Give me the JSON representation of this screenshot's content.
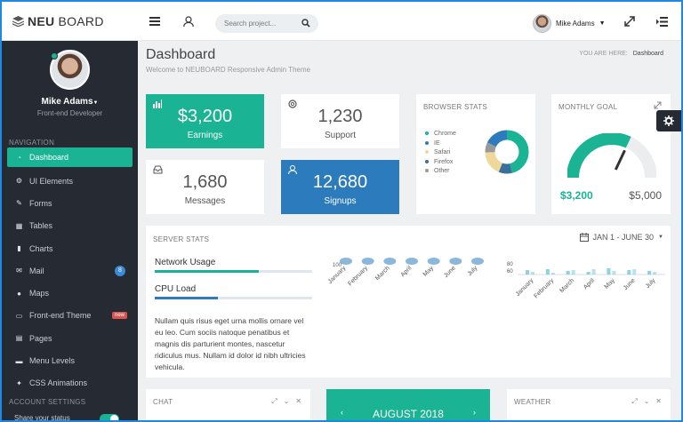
{
  "brand": {
    "logo_bold": "NEU",
    "logo_rest": "BOARD"
  },
  "topbar": {
    "search_placeholder": "Search project...",
    "user_name": "Mike Adams",
    "icons": [
      "menu-icon",
      "user-icon",
      "search-icon",
      "expand-icon",
      "list-toggle-icon"
    ]
  },
  "sidebar": {
    "profile_name": "Mike Adams",
    "profile_role": "Front-end Developer",
    "nav_heading": "NAVIGATION",
    "items": [
      {
        "label": "Dashboard",
        "icon": "dashboard-icon"
      },
      {
        "label": "UI Elements",
        "icon": "cogs-icon"
      },
      {
        "label": "Forms",
        "icon": "edit-icon"
      },
      {
        "label": "Tables",
        "icon": "table-icon"
      },
      {
        "label": "Charts",
        "icon": "bar-chart-icon"
      },
      {
        "label": "Mail",
        "icon": "mail-icon",
        "badge": "8"
      },
      {
        "label": "Maps",
        "icon": "map-marker-icon"
      },
      {
        "label": "Front-end Theme",
        "icon": "desktop-icon",
        "badge": "new"
      },
      {
        "label": "Pages",
        "icon": "file-icon"
      },
      {
        "label": "Menu Levels",
        "icon": "folder-icon"
      },
      {
        "label": "CSS Animations",
        "icon": "magic-icon"
      }
    ],
    "settings_heading": "ACCOUNT SETTINGS",
    "status_label": "Share your status",
    "accent": "#1ab394"
  },
  "page": {
    "title": "Dashboard",
    "subtitle": "Welcome to NEUBOARD Responsive Admin Theme",
    "breadcrumb_label": "YOU ARE HERE:",
    "breadcrumb_current": "Dashboard"
  },
  "stats": [
    {
      "value": "$3,200",
      "label": "Earnings"
    },
    {
      "value": "1,230",
      "label": "Support"
    },
    {
      "value": "1,680",
      "label": "Messages"
    },
    {
      "value": "12,680",
      "label": "Signups"
    }
  ],
  "browser_stats": {
    "title": "BROWSER STATS",
    "legend": [
      {
        "name": "Chrome",
        "color": "#1ab394"
      },
      {
        "name": "IE",
        "color": "#2b7bbd"
      },
      {
        "name": "Safari",
        "color": "#f0d79a"
      },
      {
        "name": "Firefox",
        "color": "#3a6f9a"
      },
      {
        "name": "Other",
        "color": "#999999"
      }
    ]
  },
  "monthly_goal": {
    "title": "MONTHLY GOAL",
    "current": "$3,200",
    "target": "$5,000",
    "progress": 0.64
  },
  "server_stats": {
    "title": "SERVER STATS",
    "date_range": "JAN 1 - JUNE 30",
    "bars": [
      {
        "label": "Network Usage",
        "value": 0.66
      },
      {
        "label": "CPU Load",
        "value": 0.4
      }
    ],
    "text": "Nullam quis risus eget urna mollis ornare vel eu leo. Cum sociis natoque penatibus et magnis dis parturient montes, nascetur ridiculus mus. Nullam id dolor id nibh ultricies vehicula."
  },
  "chart_data": [
    {
      "type": "line",
      "x": [
        "January",
        "February",
        "March",
        "April",
        "May",
        "June",
        "July"
      ],
      "ytick_shown": "100"
    },
    {
      "type": "bar",
      "categories": [
        "January",
        "February",
        "March",
        "April",
        "May",
        "June",
        "July"
      ],
      "yticks_shown": [
        "80",
        "60"
      ]
    }
  ],
  "bottom": {
    "chat_title": "CHAT",
    "calendar_month": "AUGUST 2018",
    "weather_title": "WEATHER"
  }
}
